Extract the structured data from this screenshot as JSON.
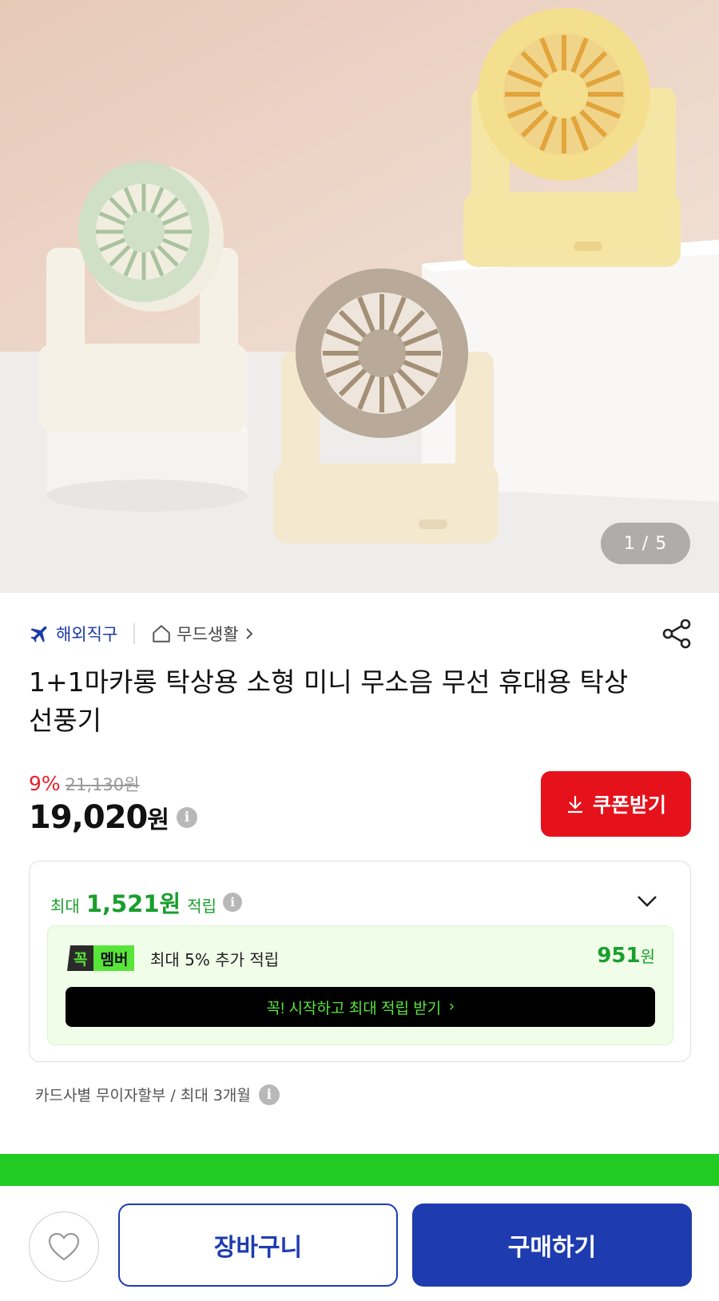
{
  "gallery": {
    "current_page": 1,
    "total_pages": 5,
    "pager_text": "1 / 5"
  },
  "meta": {
    "shipping_type": "해외직구",
    "store_name": "무드생활"
  },
  "product": {
    "title": "1+1마카롱 탁상용 소형 미니 무소음 무선 휴대용 탁상 선풍기"
  },
  "pricing": {
    "discount_rate": "9%",
    "original_price": "21,130원",
    "sale_price": "19,020",
    "sale_price_unit": "원",
    "coupon_label": "쿠폰받기"
  },
  "points": {
    "prefix": "최대",
    "amount": "1,521원",
    "suffix": "적립",
    "member_badge_a": "꼭",
    "member_badge_b": "멤버",
    "member_text": "최대 5% 추가 적립",
    "member_amount": "951",
    "member_amount_unit": "원",
    "member_cta": "꼭! 시작하고 최대 적립 받기",
    "member_cta_arrow": "›"
  },
  "installment": {
    "text": "카드사별 무이자할부 / 최대 3개월"
  },
  "bottom": {
    "cart_label": "장바구니",
    "buy_label": "구매하기"
  },
  "colors": {
    "accent_blue": "#1e3cb0",
    "discount_red": "#e8202a",
    "coupon_red": "#e5121b",
    "point_green": "#1a9e2d",
    "band_green": "#22cc22"
  },
  "icons": {
    "shipping": "airplane-icon",
    "store": "home-icon",
    "share": "share-icon",
    "info": "info-icon",
    "download": "download-icon",
    "expand": "chevron-down-icon",
    "wishlist": "heart-icon"
  }
}
